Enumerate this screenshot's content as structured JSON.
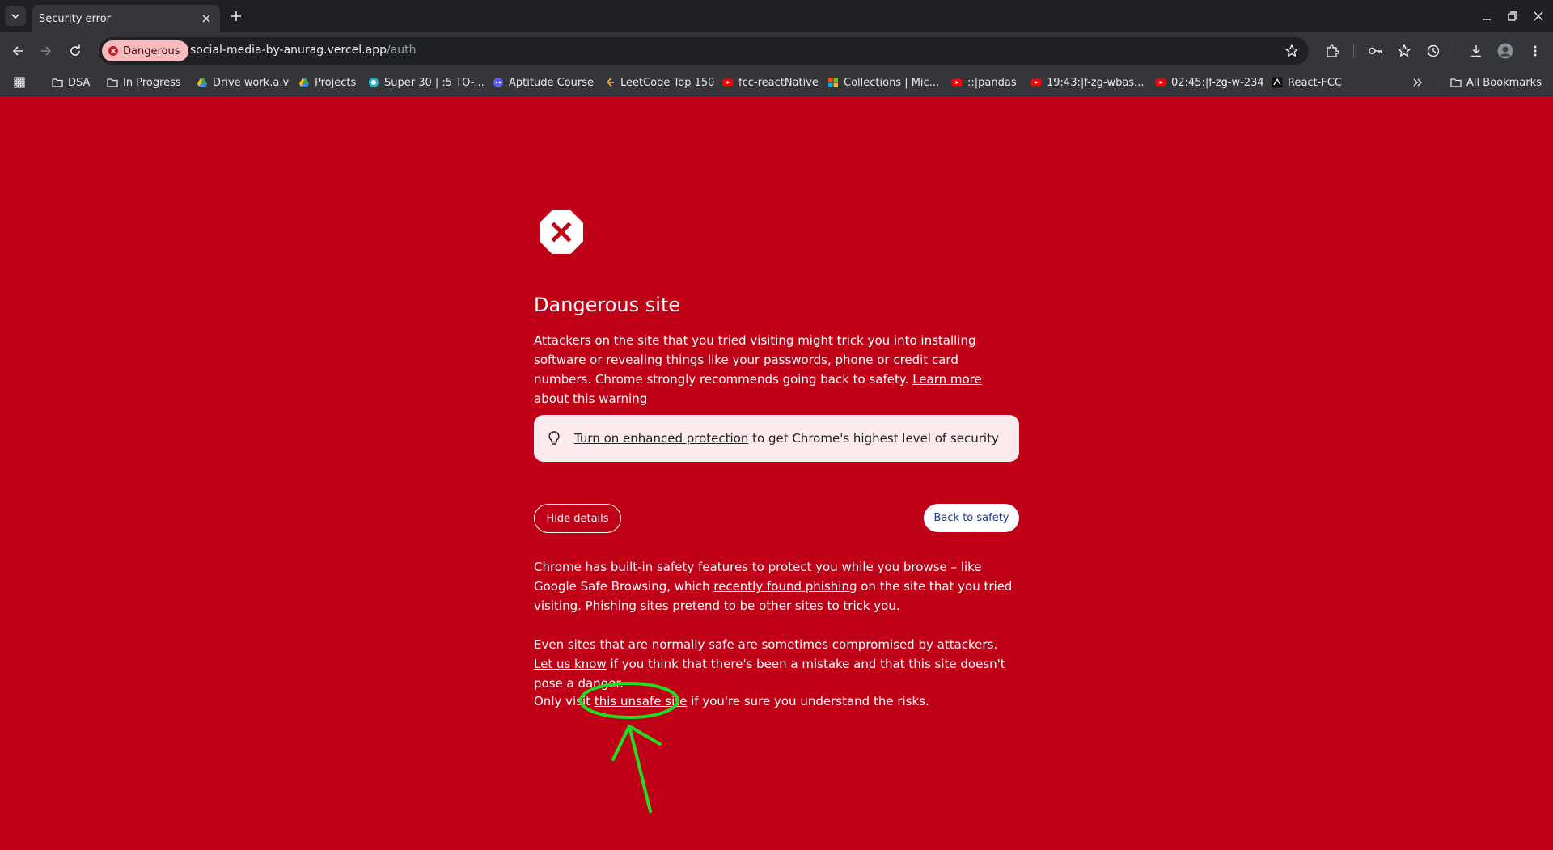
{
  "browser": {
    "tab_title": "Security error",
    "security_chip": "Dangerous",
    "url_host": "social-media-by-anurag.vercel.app",
    "url_path": "/auth"
  },
  "bookmarks": [
    {
      "label": "DSA",
      "icon": "folder-icon"
    },
    {
      "label": "In Progress",
      "icon": "folder-icon"
    },
    {
      "label": "Drive work.a.v",
      "icon": "drive-icon"
    },
    {
      "label": "Projects",
      "icon": "drive-icon"
    },
    {
      "label": "Super 30 | :5 TO-...",
      "icon": "site-icon"
    },
    {
      "label": "Aptitude Course",
      "icon": "site-icon"
    },
    {
      "label": "LeetCode Top 150",
      "icon": "leetcode-icon"
    },
    {
      "label": "fcc-reactNative",
      "icon": "youtube-icon"
    },
    {
      "label": "Collections | Mic...",
      "icon": "microsoft-icon"
    },
    {
      "label": "::|pandas",
      "icon": "youtube-icon"
    },
    {
      "label": "19:43:|f-zg-wbas...",
      "icon": "youtube-icon"
    },
    {
      "label": "02:45:|f-zg-w-234",
      "icon": "youtube-icon"
    },
    {
      "label": "React-FCC",
      "icon": "site-icon"
    }
  ],
  "all_bookmarks_label": "All Bookmarks",
  "page": {
    "heading": "Dangerous site",
    "intro": "Attackers on the site that you tried visiting might trick you into installing software or revealing things like your passwords, phone or credit card numbers. Chrome strongly recommends going back to safety.",
    "learn_more": "Learn more about this warning",
    "protection_link": "Turn on enhanced protection",
    "protection_text": " to get Chrome's highest level of security",
    "hide_details": "Hide details",
    "back_to_safety": "Back to safety",
    "details1_a": "Chrome has built-in safety features to protect you while you browse – like Google Safe Browsing, which ",
    "details1_link": "recently found phishing",
    "details1_b": " on the site that you tried visiting. Phishing sites pretend to be other sites to trick you.",
    "details2_a": "Even sites that are normally safe are sometimes compromised by attackers. ",
    "details2_link": "Let us know",
    "details2_b": " if you think that there's been a mistake and that this site doesn't pose a danger.",
    "details3_a": "Only visit ",
    "details3_link": "this unsafe site",
    "details3_b": " if you're sure you understand the risks."
  },
  "colors": {
    "page_bg": "#c00016",
    "annotation": "#22dd22"
  }
}
